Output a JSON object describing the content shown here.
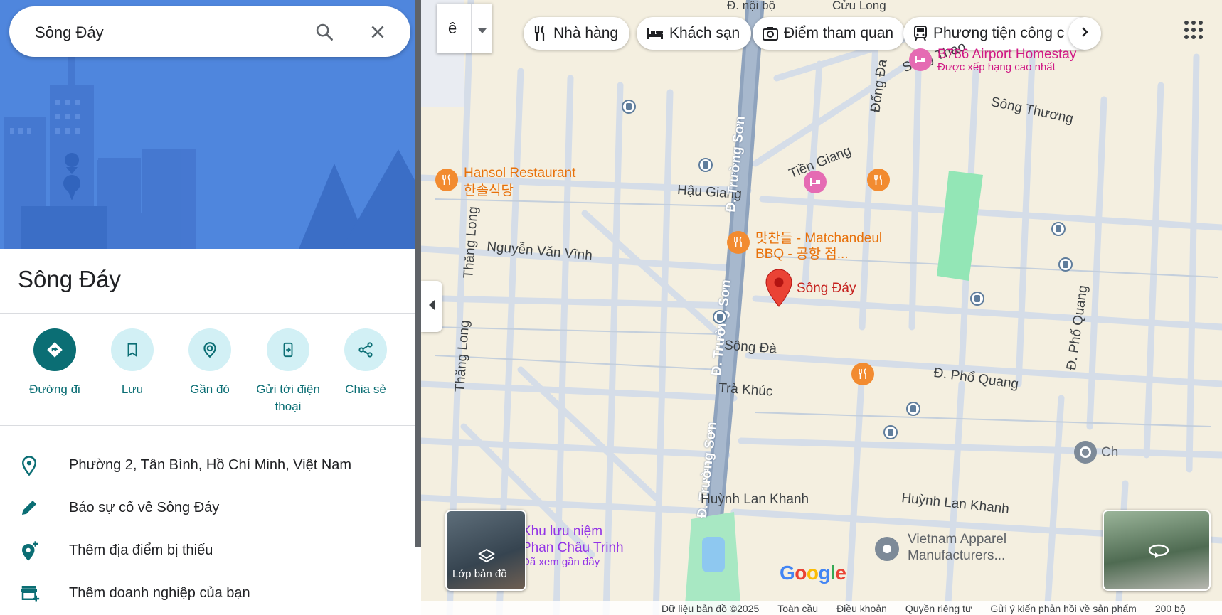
{
  "search": {
    "query": "Sông Đáy"
  },
  "place": {
    "title": "Sông Đáy"
  },
  "actions": [
    {
      "label": "Đường đi"
    },
    {
      "label": "Lưu"
    },
    {
      "label": "Gần đó"
    },
    {
      "label": "Gửi tới điện thoại"
    },
    {
      "label": "Chia sẻ"
    }
  ],
  "info": {
    "address": "Phường 2, Tân Bình, Hồ Chí Minh, Việt Nam",
    "report": "Báo sự cố về Sông Đáy",
    "add_missing": "Thêm địa điểm bị thiếu",
    "add_business": "Thêm doanh nghiệp của bạn"
  },
  "map": {
    "zoom_label": "ê",
    "chips": [
      "Nhà hàng",
      "Khách sạn",
      "Điểm tham quan",
      "Phương tiện công c"
    ],
    "roads": {
      "d_noi_bo": "Đ. nội bộ",
      "cuu_long": "Cửu Long",
      "song_thao": "Sông Thao",
      "dong_da": "Đống Đa",
      "song_thuong": "Sông Thương",
      "tien_giang": "Tiền Giang",
      "hau_giang": "Hậu Giang",
      "truong_son": "Đ. Trường Sơn",
      "thang_long": "Thăng Long",
      "nguyen_van_vinh": "Nguyễn Văn Vĩnh",
      "song_da": "Sông Đà",
      "tra_khuc": "Trà Khúc",
      "pho_quang": "Đ. Phổ Quang",
      "huynh_lan_khanh": "Huỳnh Lan Khanh"
    },
    "pois": {
      "hansol": "Hansol Restaurant",
      "hansol_kr": "한솔식당",
      "matchandeul": "맛찬들 - Matchandeul",
      "matchandeul_2": "BBQ - 공항 점...",
      "b786": "B786 Airport Homestay",
      "b786_sub": "Được xếp hạng cao nhất",
      "pin": "Sông Đáy",
      "khu_luu_niem": "Khu lưu niệm",
      "phan_chau_trinh": "Phan Châu Trinh",
      "visited": "Đã xem gần đây",
      "vietnam_apparel": "Vietnam Apparel",
      "manufacturers": "Manufacturers...",
      "ch": "Ch"
    },
    "layers_label": "Lớp bản đồ",
    "google": "Google",
    "footer": [
      "Dữ liệu bản đồ ©2025",
      "Toàn cầu",
      "Điều khoản",
      "Quyền riêng tư",
      "Gửi ý kiến phản hồi về sản phẩm",
      "200 bộ"
    ]
  },
  "colors": {
    "accent": "#0b6e74",
    "hero": "#4f86dd",
    "pin": "#ea4335"
  }
}
